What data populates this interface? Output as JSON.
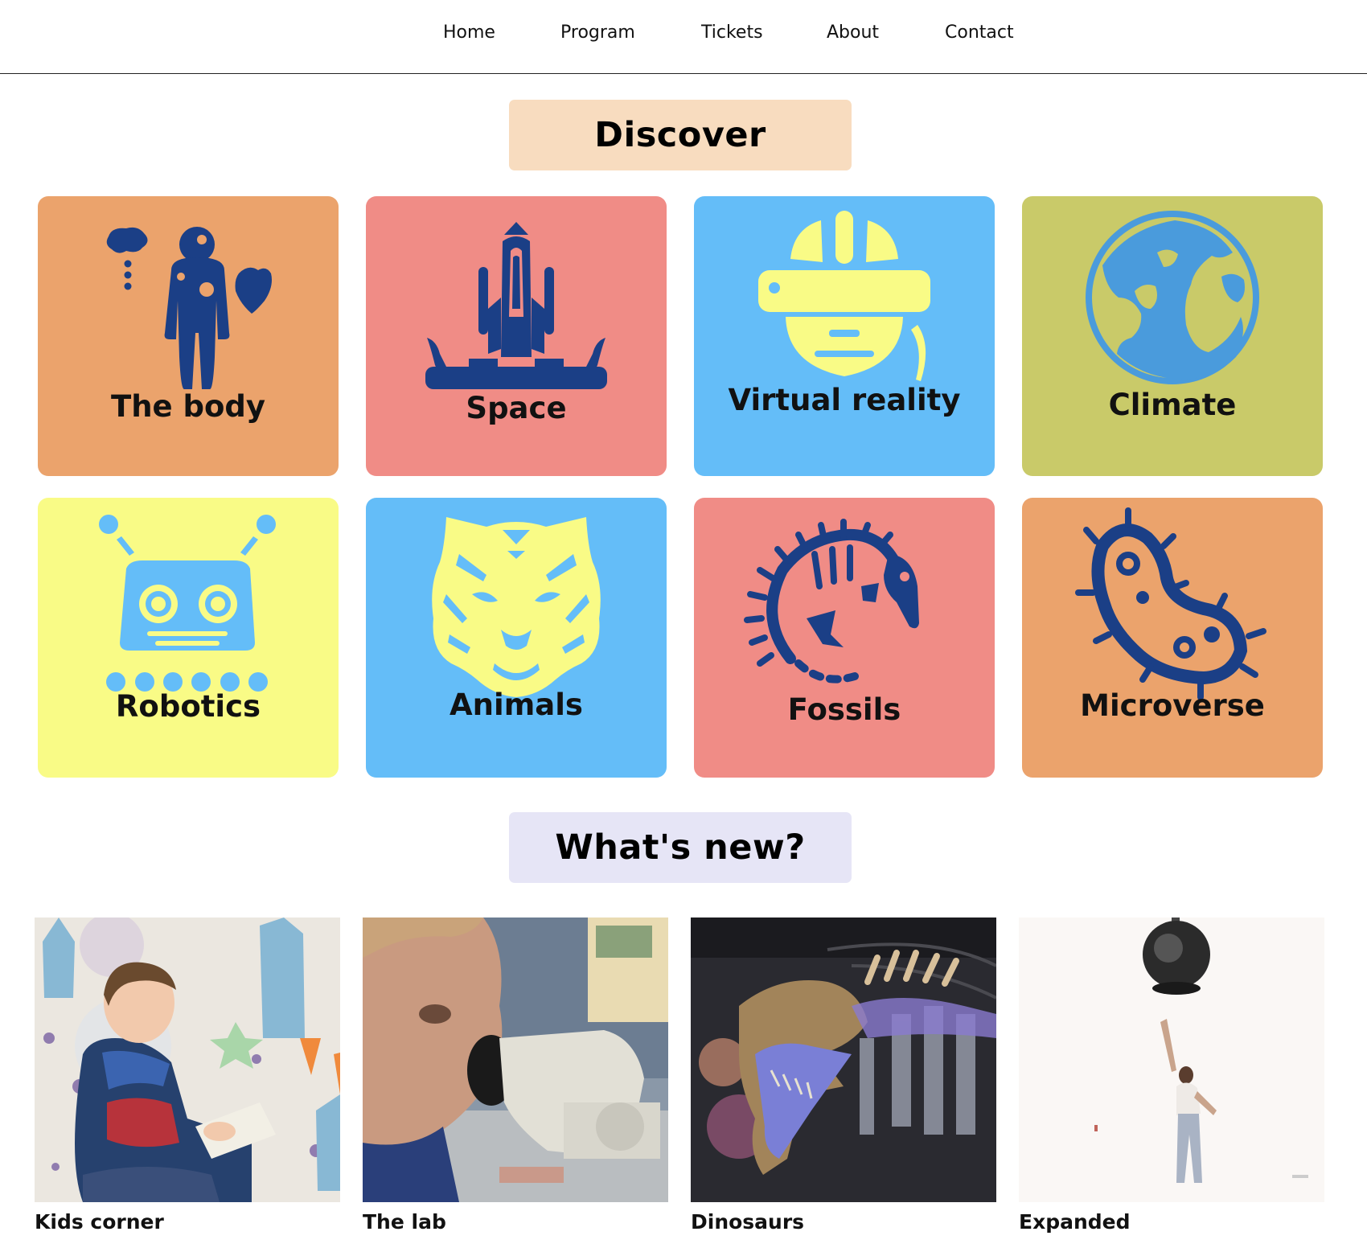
{
  "nav": {
    "items": [
      {
        "label": "Home"
      },
      {
        "label": "Program"
      },
      {
        "label": "Tickets"
      },
      {
        "label": "About"
      },
      {
        "label": "Contact"
      }
    ]
  },
  "discover": {
    "heading": "Discover",
    "heading_bg": "#f8dcbf",
    "tiles": [
      {
        "label": "The body",
        "icon": "human-body-icon",
        "bg": "#eba36c",
        "icon_color": "#1b3f86"
      },
      {
        "label": "Space",
        "icon": "space-shuttle-icon",
        "bg": "#f08c86",
        "icon_color": "#1b3f86"
      },
      {
        "label": "Virtual reality",
        "icon": "vr-headset-icon",
        "bg": "#64bdf8",
        "icon_color": "#f9fb86"
      },
      {
        "label": "Climate",
        "icon": "earth-globe-icon",
        "bg": "#c9ca69",
        "icon_color": "#4a9bdc"
      },
      {
        "label": "Robotics",
        "icon": "robot-icon",
        "bg": "#f9fb86",
        "icon_color": "#64bdf8"
      },
      {
        "label": "Animals",
        "icon": "tiger-icon",
        "bg": "#64bdf8",
        "icon_color": "#f9fb86"
      },
      {
        "label": "Fossils",
        "icon": "fossil-icon",
        "bg": "#f08c86",
        "icon_color": "#1b3f86"
      },
      {
        "label": "Microverse",
        "icon": "microbe-icon",
        "bg": "#eba36c",
        "icon_color": "#1b3f86"
      }
    ]
  },
  "whats_new": {
    "heading": "What's new?",
    "heading_bg": "#e6e5f6",
    "cards": [
      {
        "title": "Kids corner",
        "image": "child-reading-photo"
      },
      {
        "title": "The lab",
        "image": "microscope-photo"
      },
      {
        "title": "Dinosaurs",
        "image": "dinosaur-skeleton-photo"
      },
      {
        "title": "Expanded",
        "image": "woman-floating-sphere-photo"
      }
    ]
  }
}
